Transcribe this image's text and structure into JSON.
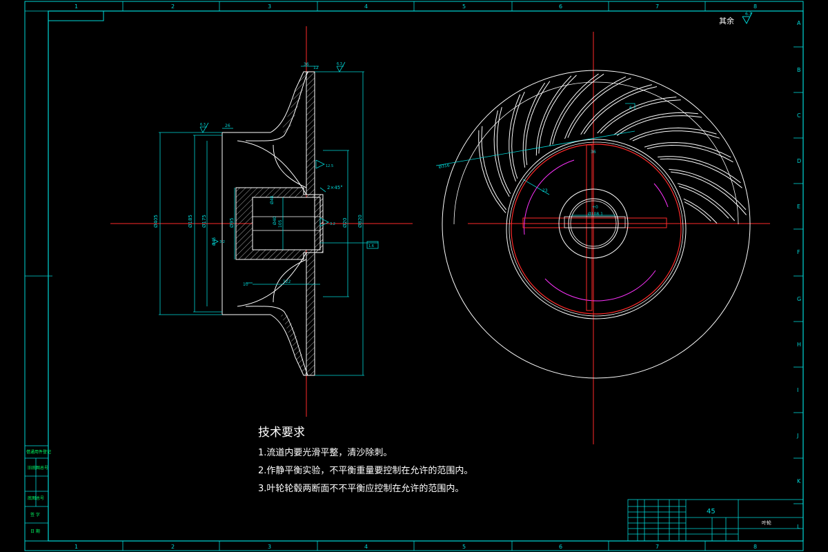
{
  "border": {
    "col_numbers": [
      "1",
      "2",
      "3",
      "4",
      "5",
      "6",
      "7",
      "8"
    ],
    "row_letters": [
      "A",
      "B",
      "C",
      "D",
      "E",
      "F",
      "G",
      "H",
      "I",
      "J",
      "K",
      "L"
    ]
  },
  "roughness_note": {
    "label": "其余",
    "value": "6.3"
  },
  "section_view": {
    "dims": {
      "d1": "Ø405",
      "d2": "Ø185",
      "d3": "Ø175",
      "d4": "Ø95",
      "d5": "Ø20",
      "d6": "Ø820",
      "d7": "Ø48",
      "d8": "Ø40",
      "d9": "Ø45",
      "w1": "36",
      "w2": "12",
      "w3": "26",
      "chamfer": "2×45°",
      "bore": "105",
      "len": "122",
      "small": "10"
    },
    "roughness": [
      "6.3",
      "6.3",
      "12.5",
      "3.2",
      "3.2",
      "1.6"
    ]
  },
  "front_view": {
    "dims": {
      "outer": "Ø316",
      "r1": "23",
      "key": "36",
      "keyway": "Ø108.1",
      "bore": "+0",
      "blade": "6"
    }
  },
  "technical_requirements": {
    "title": "技术要求",
    "lines": [
      "1.流道内要光滑平整，清沙除刺。",
      "2.作静平衡实验，不平衡重量要控制在允许的范围内。",
      "3.叶轮轮毂两断面不不平衡应控制在允许的范围内。"
    ]
  },
  "title_block": {
    "material": "45",
    "part_name": "叶轮"
  },
  "left_strip": {
    "labels": [
      "借通用件登记",
      "旧底图总号",
      "底图总号",
      "签 字",
      "日 期"
    ]
  }
}
